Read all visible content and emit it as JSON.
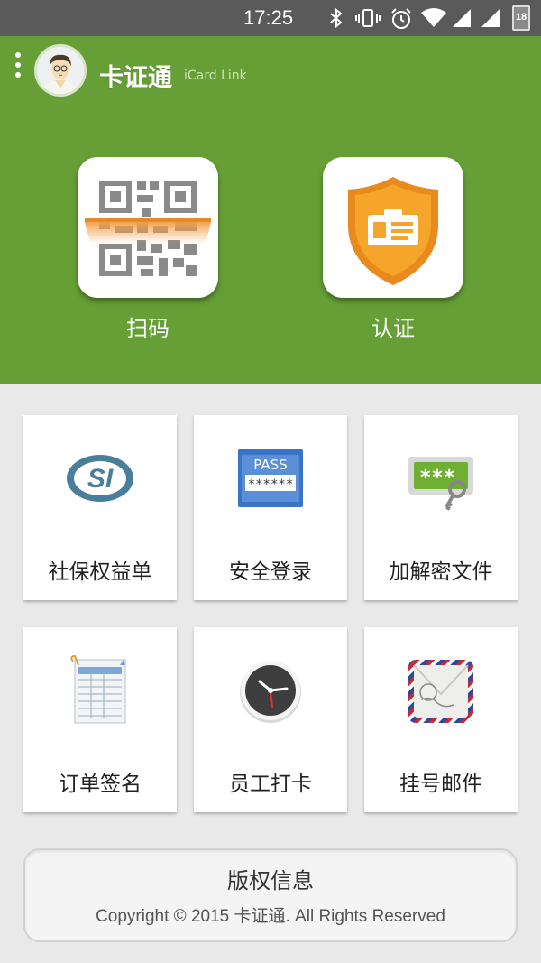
{
  "status_bar": {
    "time": "17:25",
    "battery_level": "18",
    "icons": [
      "bluetooth-icon",
      "vibrate-icon",
      "alarm-icon",
      "wifi-icon",
      "signal-icon",
      "signal-icon",
      "battery-icon"
    ]
  },
  "header": {
    "title": "卡证通",
    "subtitle": "iCard Link",
    "background_color": "#669f36"
  },
  "main_actions": [
    {
      "label": "扫码",
      "icon": "qr-scan-icon"
    },
    {
      "label": "认证",
      "icon": "shield-id-icon"
    }
  ],
  "grid": [
    {
      "label": "社保权益单",
      "icon": "social-security-icon"
    },
    {
      "label": "安全登录",
      "icon": "password-card-icon"
    },
    {
      "label": "加解密文件",
      "icon": "encrypted-key-icon"
    },
    {
      "label": "订单签名",
      "icon": "order-sheet-icon"
    },
    {
      "label": "员工打卡",
      "icon": "clock-icon"
    },
    {
      "label": "挂号邮件",
      "icon": "registered-mail-icon"
    }
  ],
  "icon_text": {
    "pass_label": "PASS",
    "pass_mask": "******",
    "key_mask": "***",
    "si_label": "SI"
  },
  "footer": {
    "title": "版权信息",
    "copyright": "Copyright © 2015 卡证通. All Rights Reserved"
  }
}
